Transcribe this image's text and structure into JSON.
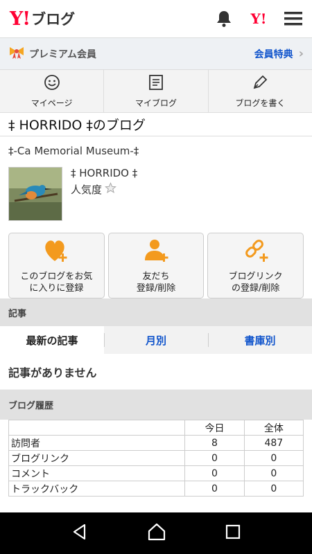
{
  "header": {
    "logo_y": "Y!",
    "logo_text": "ブログ",
    "y_mark": "Y!",
    "icons": [
      "bell-icon",
      "yahoo-icon",
      "menu-icon"
    ]
  },
  "premium": {
    "label": "プレミアム会員",
    "link": "会員特典",
    "icon": "ribbon-icon"
  },
  "nav": [
    {
      "label": "マイページ",
      "icon": "smiley-icon"
    },
    {
      "label": "マイブログ",
      "icon": "notebook-icon"
    },
    {
      "label": "ブログを書く",
      "icon": "pen-icon"
    }
  ],
  "blog": {
    "title": "‡ HORRIDO ‡のブログ",
    "subtitle": "‡-Ca Memorial Museum-‡",
    "owner": "‡ HORRIDO ‡",
    "popularity_label": "人気度"
  },
  "actions": [
    {
      "line1": "このブログをお気",
      "line2": "に入りに登録",
      "icon": "heart-plus-icon"
    },
    {
      "line1": "友だち",
      "line2": "登録/削除",
      "icon": "person-plus-icon"
    },
    {
      "line1": "ブログリンク",
      "line2": "の登録/削除",
      "icon": "link-plus-icon"
    }
  ],
  "articles": {
    "heading": "記事",
    "tabs": [
      "最新の記事",
      "月別",
      "書庫別"
    ],
    "empty": "記事がありません"
  },
  "history": {
    "heading": "ブログ履歴",
    "columns": [
      "",
      "今日",
      "全体"
    ],
    "rows": [
      {
        "label": "訪問者",
        "today": "8",
        "total": "487"
      },
      {
        "label": "ブログリンク",
        "today": "0",
        "total": "0"
      },
      {
        "label": "コメント",
        "today": "0",
        "total": "0"
      },
      {
        "label": "トラックバック",
        "today": "0",
        "total": "0"
      }
    ]
  },
  "colors": {
    "accent_red": "#ff0033",
    "link_blue": "#1155cc",
    "action_orange": "#f39a1e"
  }
}
